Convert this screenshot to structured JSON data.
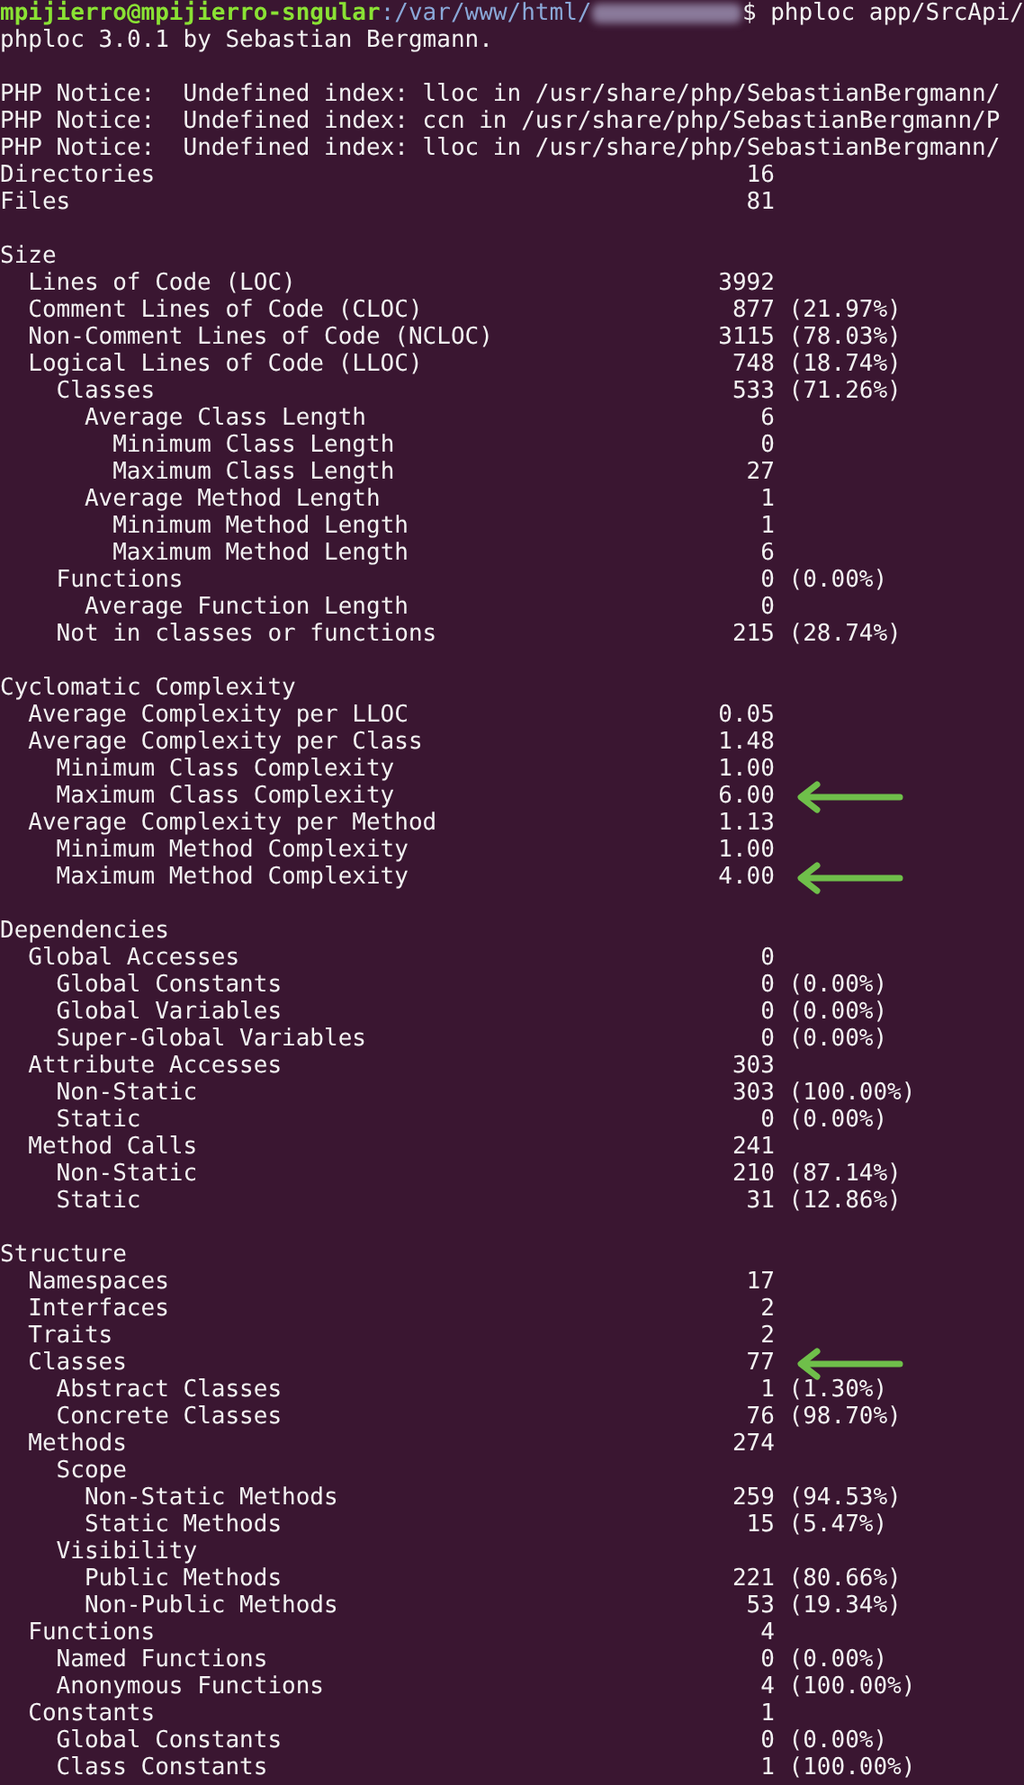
{
  "terminal": {
    "prompt": {
      "user_host": "mpijierro@mpijierro-sngular",
      "path": ":/var/www/html/",
      "symbol": "$",
      "command": "phploc app/SrcApi/"
    },
    "banner": "phploc 3.0.1 by Sebastian Bergmann.",
    "notices": [
      "PHP Notice:  Undefined index: lloc in /usr/share/php/SebastianBergmann/",
      "PHP Notice:  Undefined index: ccn in /usr/share/php/SebastianBergmann/P",
      "PHP Notice:  Undefined index: lloc in /usr/share/php/SebastianBergmann/"
    ],
    "summary": [
      {
        "label": "Directories",
        "value": "16",
        "arrow": false
      },
      {
        "label": "Files",
        "value": "81",
        "arrow": false
      }
    ],
    "sections": [
      {
        "title": "Size",
        "items": [
          {
            "label": "Lines of Code (LOC)",
            "value": "3992",
            "arrow": false
          },
          {
            "label": "Comment Lines of Code (CLOC)",
            "value": "877",
            "pct": "(21.97%)",
            "arrow": false
          },
          {
            "label": "Non-Comment Lines of Code (NCLOC)",
            "value": "3115",
            "pct": "(78.03%)",
            "arrow": false
          },
          {
            "label": "Logical Lines of Code (LLOC)",
            "value": "748",
            "pct": "(18.74%)",
            "arrow": false,
            "children": [
              {
                "label": "Classes",
                "value": "533",
                "pct": "(71.26%)",
                "arrow": false,
                "children": [
                  {
                    "label": "Average Class Length",
                    "value": "6",
                    "arrow": false,
                    "children": [
                      {
                        "label": "Minimum Class Length",
                        "value": "0",
                        "arrow": false
                      },
                      {
                        "label": "Maximum Class Length",
                        "value": "27",
                        "arrow": false
                      }
                    ]
                  },
                  {
                    "label": "Average Method Length",
                    "value": "1",
                    "arrow": false,
                    "children": [
                      {
                        "label": "Minimum Method Length",
                        "value": "1",
                        "arrow": false
                      },
                      {
                        "label": "Maximum Method Length",
                        "value": "6",
                        "arrow": false
                      }
                    ]
                  }
                ]
              },
              {
                "label": "Functions",
                "value": "0",
                "pct": "(0.00%)",
                "arrow": false,
                "children": [
                  {
                    "label": "Average Function Length",
                    "value": "0",
                    "arrow": false
                  }
                ]
              },
              {
                "label": "Not in classes or functions",
                "value": "215",
                "pct": "(28.74%)",
                "arrow": false
              }
            ]
          }
        ]
      },
      {
        "title": "Cyclomatic Complexity",
        "items": [
          {
            "label": "Average Complexity per LLOC",
            "value": "0.05",
            "arrow": false
          },
          {
            "label": "Average Complexity per Class",
            "value": "1.48",
            "arrow": false,
            "children": [
              {
                "label": "Minimum Class Complexity",
                "value": "1.00",
                "arrow": false
              },
              {
                "label": "Maximum Class Complexity",
                "value": "6.00",
                "arrow": true
              }
            ]
          },
          {
            "label": "Average Complexity per Method",
            "value": "1.13",
            "arrow": false,
            "children": [
              {
                "label": "Minimum Method Complexity",
                "value": "1.00",
                "arrow": false
              },
              {
                "label": "Maximum Method Complexity",
                "value": "4.00",
                "arrow": true
              }
            ]
          }
        ]
      },
      {
        "title": "Dependencies",
        "items": [
          {
            "label": "Global Accesses",
            "value": "0",
            "arrow": false,
            "children": [
              {
                "label": "Global Constants",
                "value": "0",
                "pct": "(0.00%)",
                "arrow": false
              },
              {
                "label": "Global Variables",
                "value": "0",
                "pct": "(0.00%)",
                "arrow": false
              },
              {
                "label": "Super-Global Variables",
                "value": "0",
                "pct": "(0.00%)",
                "arrow": false
              }
            ]
          },
          {
            "label": "Attribute Accesses",
            "value": "303",
            "arrow": false,
            "children": [
              {
                "label": "Non-Static",
                "value": "303",
                "pct": "(100.00%)",
                "arrow": false
              },
              {
                "label": "Static",
                "value": "0",
                "pct": "(0.00%)",
                "arrow": false
              }
            ]
          },
          {
            "label": "Method Calls",
            "value": "241",
            "arrow": false,
            "children": [
              {
                "label": "Non-Static",
                "value": "210",
                "pct": "(87.14%)",
                "arrow": false
              },
              {
                "label": "Static",
                "value": "31",
                "pct": "(12.86%)",
                "arrow": false
              }
            ]
          }
        ]
      },
      {
        "title": "Structure",
        "items": [
          {
            "label": "Namespaces",
            "value": "17",
            "arrow": false
          },
          {
            "label": "Interfaces",
            "value": "2",
            "arrow": false
          },
          {
            "label": "Traits",
            "value": "2",
            "arrow": false
          },
          {
            "label": "Classes",
            "value": "77",
            "arrow": true,
            "children": [
              {
                "label": "Abstract Classes",
                "value": "1",
                "pct": "(1.30%)",
                "arrow": false
              },
              {
                "label": "Concrete Classes",
                "value": "76",
                "pct": "(98.70%)",
                "arrow": false
              }
            ]
          },
          {
            "label": "Methods",
            "value": "274",
            "arrow": false,
            "children": [
              {
                "label": "Scope",
                "arrow": false,
                "children": [
                  {
                    "label": "Non-Static Methods",
                    "value": "259",
                    "pct": "(94.53%)",
                    "arrow": false
                  },
                  {
                    "label": "Static Methods",
                    "value": "15",
                    "pct": "(5.47%)",
                    "arrow": false
                  }
                ]
              },
              {
                "label": "Visibility",
                "arrow": false,
                "children": [
                  {
                    "label": "Public Methods",
                    "value": "221",
                    "pct": "(80.66%)",
                    "arrow": false
                  },
                  {
                    "label": "Non-Public Methods",
                    "value": "53",
                    "pct": "(19.34%)",
                    "arrow": false
                  }
                ]
              }
            ]
          },
          {
            "label": "Functions",
            "value": "4",
            "arrow": false,
            "children": [
              {
                "label": "Named Functions",
                "value": "0",
                "pct": "(0.00%)",
                "arrow": false
              },
              {
                "label": "Anonymous Functions",
                "value": "4",
                "pct": "(100.00%)",
                "arrow": false
              }
            ]
          },
          {
            "label": "Constants",
            "value": "1",
            "arrow": false,
            "children": [
              {
                "label": "Global Constants",
                "value": "0",
                "pct": "(0.00%)",
                "arrow": false
              },
              {
                "label": "Class Constants",
                "value": "1",
                "pct": "(100.00%)",
                "arrow": false
              }
            ]
          }
        ]
      }
    ]
  }
}
